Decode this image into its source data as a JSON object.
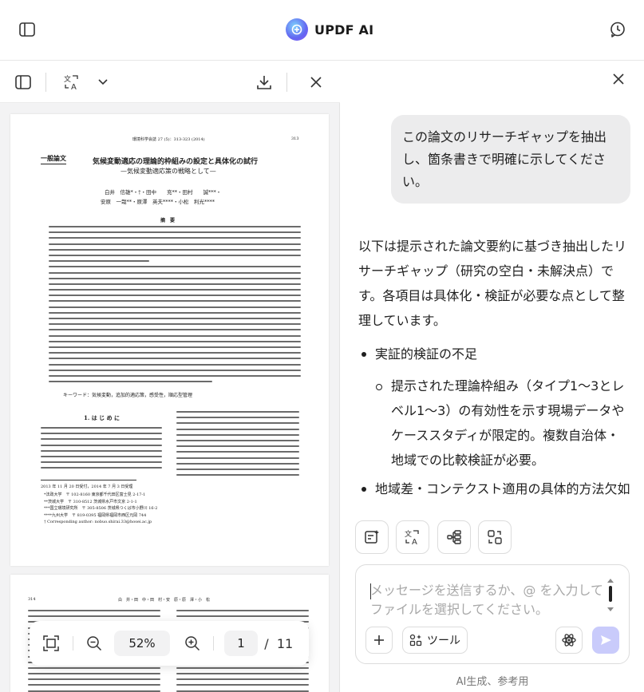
{
  "app": {
    "title": "UPDF AI"
  },
  "document_viewer": {
    "zoom": "52%",
    "current_page": "1",
    "page_separator": "/",
    "total_pages": "11",
    "page1": {
      "journal_header": "環境科学会誌 27 (5)：313-323 (2014)",
      "page_number": "313",
      "category": "一般論文",
      "title": "気候変動適応の理論的枠組みの設定と具体化の試行",
      "subtitle": "—気候変動適応策の戦略として—",
      "authors_line1": "白井　信雄*・†・田中　　充**・田村　　誠***・",
      "authors_line2": "安原　一哉**・原澤　英夫****・小松　利光****",
      "abstract_heading": "摘　要",
      "keywords": "キーワード：気候変動，追加的適応策，感受性，順応型管理",
      "section_heading": "1. は じ め に",
      "received": "2013 年 11 月 20 日受付，2014 年 7 月 3 日受理",
      "affiliations": [
        "*法政大学　〒 102-8160 東京都千代田区富士見 2-17-1",
        "**茨城大学　〒 310-8512 茨城県水戸市文京 2-1-1",
        "***国立環境研究所　〒 305-8506 茨城県つくば市小野川 16-2",
        "****九州大学　〒 819-0395 福岡県福岡市西区元岡 744",
        "† Corresponding author: nobuo.shirai.33@hosei.ac.jp"
      ]
    },
    "page2": {
      "page_number": "314",
      "running_head": "白　井・田　中・田　村・安　原・原　澤・小　松"
    }
  },
  "chat": {
    "user_message": "この論文のリサーチギャップを抽出し、箇条書きで明確に示してください。",
    "ai_intro": "以下は提示された論文要約に基づき抽出したリサーチギャップ（研究の空白・未解決点）です。各項目は具体化・検証が必要な点として整理しています。",
    "bullets": [
      {
        "title": "実証的検証の不足",
        "sub": "提示された理論枠組み（タイプ1〜3とレベル1〜3）の有効性を示す現場データやケーススタディが限定的。複数自治体・地域での比較検証が必要。"
      },
      {
        "title": "地域差・コンテクスト適用の具体的方法欠如"
      }
    ],
    "input_placeholder": "メッセージを送信するか、@ を入力してファイルを選択してください。",
    "tools_label": "ツール",
    "disclaimer": "AI生成、参考用"
  }
}
